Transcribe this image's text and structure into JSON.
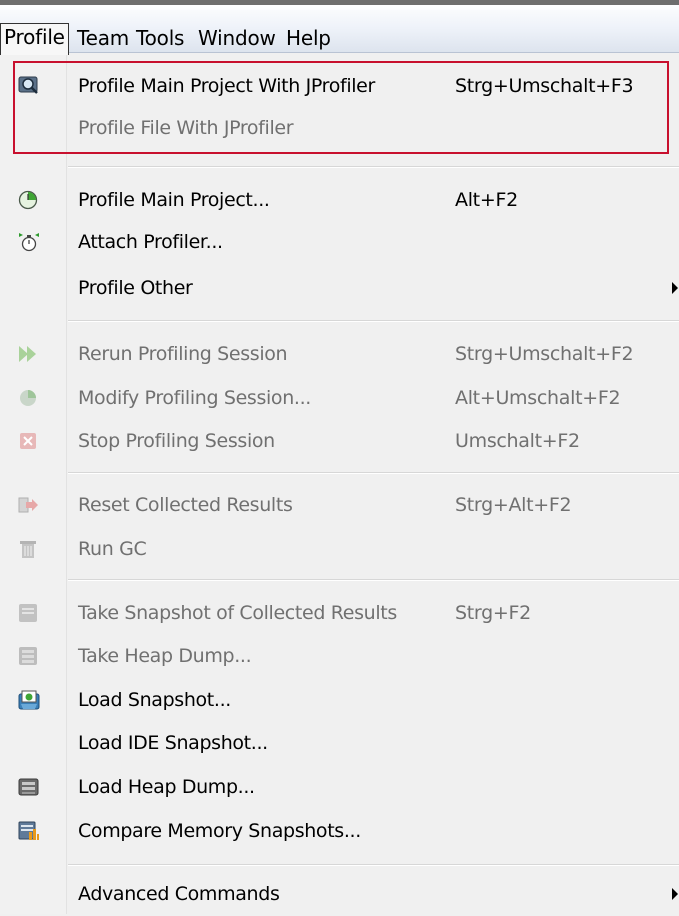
{
  "menubar": {
    "items": [
      "Profile",
      "Team",
      "Tools",
      "Window",
      "Help"
    ]
  },
  "menu": {
    "items": [
      {
        "label": "Profile Main Project With JProfiler",
        "shortcut": "Strg+Umschalt+F3",
        "icon": "profiler-magnifier-icon",
        "enabled": true
      },
      {
        "label": "Profile File With JProfiler",
        "shortcut": "",
        "icon": "",
        "enabled": false
      },
      {
        "label": "Profile Main Project...",
        "shortcut": "Alt+F2",
        "icon": "profile-clock-icon",
        "enabled": true
      },
      {
        "label": "Attach Profiler...",
        "shortcut": "",
        "icon": "attach-stopwatch-icon",
        "enabled": true
      },
      {
        "label": "Profile Other",
        "shortcut": "",
        "icon": "",
        "enabled": true,
        "submenu": true
      },
      {
        "label": "Rerun Profiling Session",
        "shortcut": "Strg+Umschalt+F2",
        "icon": "rerun-icon",
        "enabled": false
      },
      {
        "label": "Modify Profiling Session...",
        "shortcut": "Alt+Umschalt+F2",
        "icon": "modify-session-icon",
        "enabled": false
      },
      {
        "label": "Stop Profiling Session",
        "shortcut": "Umschalt+F2",
        "icon": "stop-icon",
        "enabled": false
      },
      {
        "label": "Reset Collected Results",
        "shortcut": "Strg+Alt+F2",
        "icon": "reset-results-icon",
        "enabled": false
      },
      {
        "label": "Run GC",
        "shortcut": "",
        "icon": "trash-icon",
        "enabled": false
      },
      {
        "label": "Take Snapshot of Collected Results",
        "shortcut": "Strg+F2",
        "icon": "snapshot-icon",
        "enabled": false
      },
      {
        "label": "Take Heap Dump...",
        "shortcut": "",
        "icon": "heap-dump-icon",
        "enabled": false
      },
      {
        "label": "Load Snapshot...",
        "shortcut": "",
        "icon": "load-snapshot-icon",
        "enabled": true
      },
      {
        "label": "Load IDE Snapshot...",
        "shortcut": "",
        "icon": "",
        "enabled": true
      },
      {
        "label": "Load Heap Dump...",
        "shortcut": "",
        "icon": "load-heap-dump-icon",
        "enabled": true
      },
      {
        "label": "Compare Memory Snapshots...",
        "shortcut": "",
        "icon": "compare-snapshots-icon",
        "enabled": true
      },
      {
        "label": "Advanced Commands",
        "shortcut": "",
        "icon": "",
        "enabled": true,
        "submenu": true
      }
    ]
  },
  "colors": {
    "highlight_border": "#c8102e",
    "disabled_text": "#707070"
  }
}
